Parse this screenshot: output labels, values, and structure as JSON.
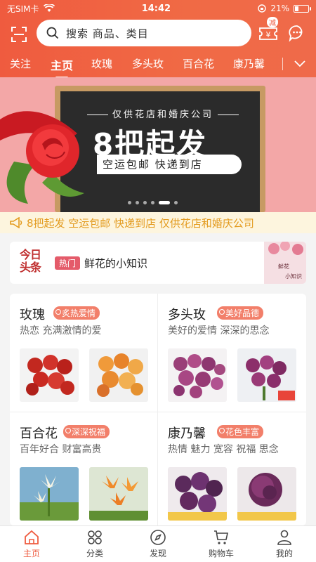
{
  "status": {
    "carrier": "无SIM卡",
    "time": "14:42",
    "battery": "21%"
  },
  "search": {
    "placeholder": "搜索 商品、类目"
  },
  "coupon_badge": "减",
  "tabs": [
    "关注",
    "主页",
    "玫瑰",
    "多头玫",
    "百合花",
    "康乃馨"
  ],
  "active_tab": "主页",
  "banner": {
    "top_line": "仅供花店和婚庆公司",
    "main": "8把起发",
    "sub": "空运包邮 快递到店",
    "slides": 6,
    "active_slide": 5
  },
  "notice": {
    "text": "8把起发 空运包邮 快递到店 仅供花店和婚庆公司"
  },
  "headline": {
    "logo_line1": "今日",
    "logo_line2": "头条",
    "tag": "热门",
    "text": "鲜花的小知识",
    "thumb_text": "鲜花 小知识"
  },
  "categories": [
    {
      "title": "玫瑰",
      "tag": "炙热爱情",
      "desc": "热恋 充满激情的爱"
    },
    {
      "title": "多头玫",
      "tag": "美好品德",
      "desc": "美好的爱情 深深的思念"
    },
    {
      "title": "百合花",
      "tag": "深深祝福",
      "desc": "百年好合 财富高贵"
    },
    {
      "title": "康乃馨",
      "tag": "花色丰富",
      "desc": "热情 魅力 宽容 祝福 思念"
    }
  ],
  "tabbar": [
    "主页",
    "分类",
    "发现",
    "购物车",
    "我的"
  ],
  "colors": {
    "brand": "#ef5b3f",
    "notice": "#e39b1f",
    "tag": "#f27f6a"
  }
}
